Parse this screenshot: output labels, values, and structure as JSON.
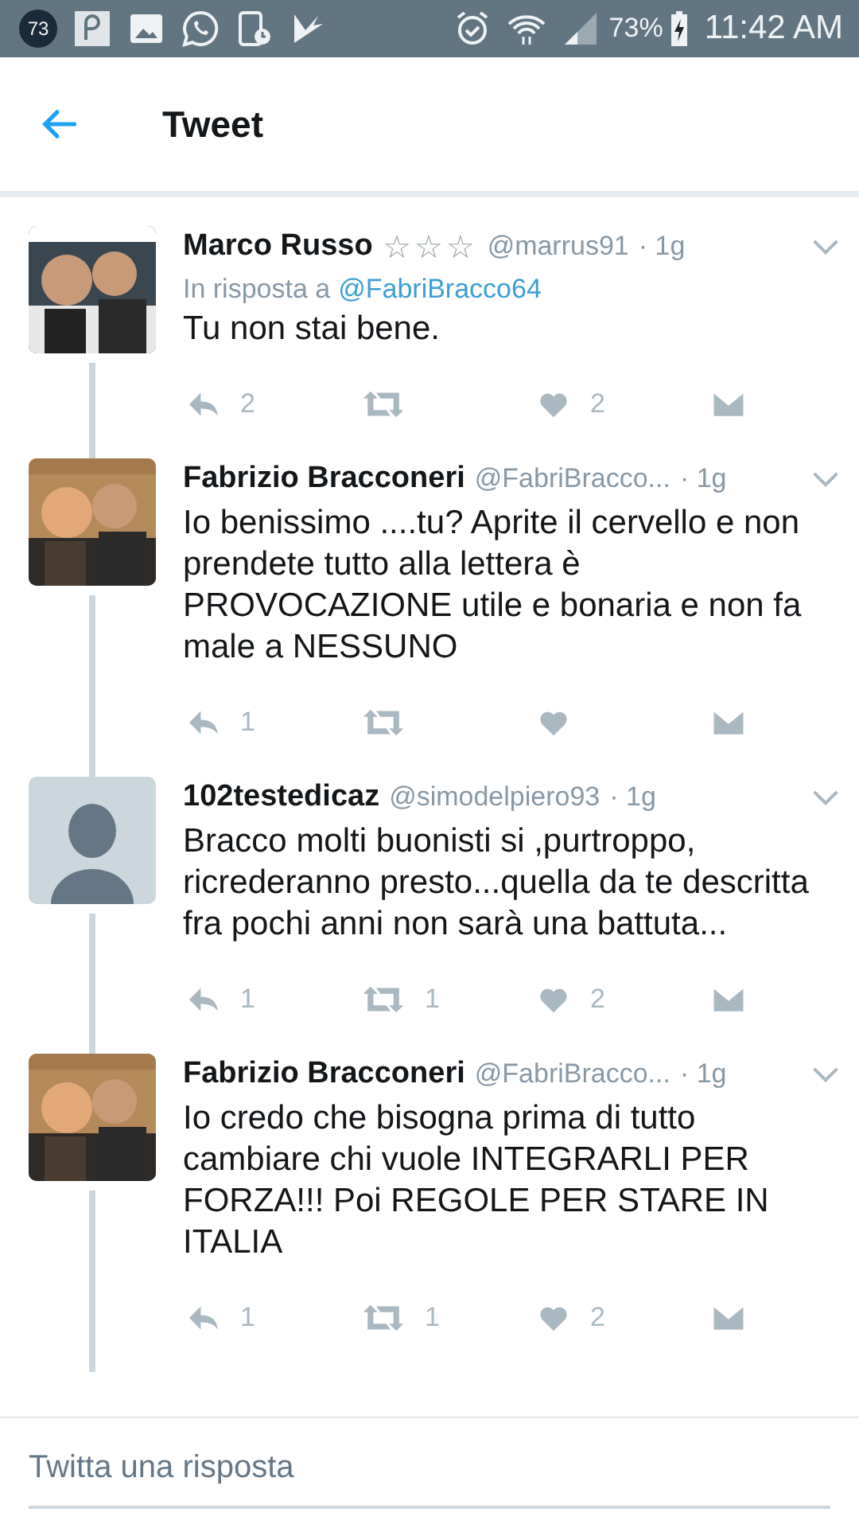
{
  "status_bar": {
    "notification_count": "73",
    "battery": "73%",
    "time": "11:42 AM"
  },
  "app_bar": {
    "title": "Tweet"
  },
  "tweets": [
    {
      "name": "Marco Russo",
      "badge": "☆☆☆",
      "handle": "@marrus91",
      "time": "· 1g",
      "reply_to": {
        "label": "In risposta a",
        "handle": "@FabriBracco64"
      },
      "text": "Tu non stai bene.",
      "replies": "2",
      "likes": "2"
    },
    {
      "name": "Fabrizio Bracconeri",
      "handle": "@FabriBracco...",
      "time": "· 1g",
      "text": "Io benissimo ....tu? Aprite il cervello e non prendete tutto alla lettera è PROVOCAZIONE utile e bonaria e non fa male a NESSUNO",
      "replies": "1"
    },
    {
      "avatar": {
        "kind": "default"
      },
      "name": "102testedicaz",
      "handle": "@simodelpiero93",
      "time": "· 1g",
      "text": "Bracco molti buonisti si ,purtroppo, ricrederanno presto...quella da te descritta fra pochi anni non sarà una battuta...",
      "replies": "1",
      "retweets": "1",
      "likes": "2"
    },
    {
      "name": "Fabrizio Bracconeri",
      "handle": "@FabriBracco...",
      "time": "· 1g",
      "text": "Io credo che bisogna prima di tutto cambiare chi vuole INTEGRARLI PER FORZA!!! Poi REGOLE PER STARE IN ITALIA",
      "replies": "1",
      "retweets": "1",
      "likes": "2"
    }
  ],
  "reply_box": {
    "placeholder": "Twitta una risposta"
  }
}
